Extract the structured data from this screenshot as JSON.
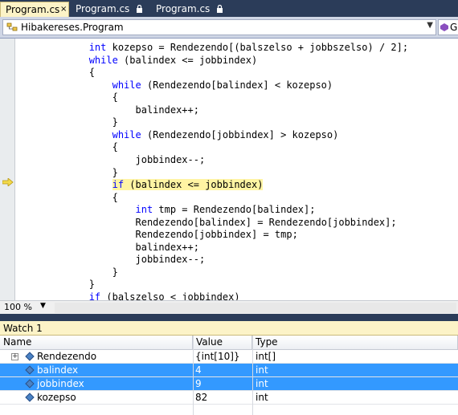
{
  "tabs": [
    {
      "label": "Program.cs",
      "active": true,
      "close_glyph": "×"
    },
    {
      "label": "Program.cs",
      "active": false,
      "locked": true
    },
    {
      "label": "Program.cs",
      "active": false,
      "locked": true
    }
  ],
  "navbar": {
    "type_combo": "Hibakereses.Program",
    "member_combo": "G"
  },
  "code": {
    "lines": [
      {
        "indent": "            ",
        "parts": [
          {
            "t": "int",
            "k": true
          },
          {
            "t": " kozepso = Rendezendo[(balszelso + jobbszelso) / 2];"
          }
        ]
      },
      {
        "indent": "            ",
        "parts": [
          {
            "t": "while",
            "k": true
          },
          {
            "t": " (balindex <= jobbindex)"
          }
        ]
      },
      {
        "indent": "            ",
        "parts": [
          {
            "t": "{"
          }
        ]
      },
      {
        "indent": "                ",
        "parts": [
          {
            "t": "while",
            "k": true
          },
          {
            "t": " (Rendezendo[balindex] < kozepso)"
          }
        ]
      },
      {
        "indent": "                ",
        "parts": [
          {
            "t": "{"
          }
        ]
      },
      {
        "indent": "                    ",
        "parts": [
          {
            "t": "balindex++;"
          }
        ]
      },
      {
        "indent": "                ",
        "parts": [
          {
            "t": "}"
          }
        ]
      },
      {
        "indent": "                ",
        "parts": [
          {
            "t": "while",
            "k": true
          },
          {
            "t": " (Rendezendo[jobbindex] > kozepso)"
          }
        ]
      },
      {
        "indent": "                ",
        "parts": [
          {
            "t": "{"
          }
        ]
      },
      {
        "indent": "                    ",
        "parts": [
          {
            "t": "jobbindex--;"
          }
        ]
      },
      {
        "indent": "                ",
        "parts": [
          {
            "t": "}"
          }
        ]
      },
      {
        "indent": "                ",
        "parts": [
          {
            "t": "if",
            "k": true
          },
          {
            "t": " (balindex <= jobbindex)"
          }
        ],
        "current": true
      },
      {
        "indent": "                ",
        "parts": [
          {
            "t": "{"
          }
        ]
      },
      {
        "indent": "                    ",
        "parts": [
          {
            "t": "int",
            "k": true
          },
          {
            "t": " tmp = Rendezendo[balindex];"
          }
        ]
      },
      {
        "indent": "                    ",
        "parts": [
          {
            "t": "Rendezendo[balindex] = Rendezendo[jobbindex];"
          }
        ]
      },
      {
        "indent": "                    ",
        "parts": [
          {
            "t": "Rendezendo[jobbindex] = tmp;"
          }
        ]
      },
      {
        "indent": "                    ",
        "parts": [
          {
            "t": "balindex++;"
          }
        ]
      },
      {
        "indent": "                    ",
        "parts": [
          {
            "t": "jobbindex--;"
          }
        ]
      },
      {
        "indent": "                ",
        "parts": [
          {
            "t": "}"
          }
        ]
      },
      {
        "indent": "            ",
        "parts": [
          {
            "t": "}"
          }
        ]
      },
      {
        "indent": "            ",
        "parts": [
          {
            "t": "if",
            "k": true
          },
          {
            "t": " (balszelso < jobbindex)"
          }
        ]
      }
    ],
    "keyword_color": "#0000ff",
    "current_line_color": "#fff4a3",
    "arrow_color": "#f2d94a"
  },
  "status": {
    "zoom": "100 %"
  },
  "watch": {
    "title": "Watch 1",
    "columns": [
      "Name",
      "Value",
      "Type"
    ],
    "rows": [
      {
        "name": "Rendezendo",
        "value": "{int[10]}",
        "type": "int[]",
        "expandable": true,
        "selected": false
      },
      {
        "name": "balindex",
        "value": "4",
        "type": "int",
        "expandable": false,
        "selected": true
      },
      {
        "name": "jobbindex",
        "value": "9",
        "type": "int",
        "expandable": false,
        "selected": true
      },
      {
        "name": "kozepso",
        "value": "82",
        "type": "int",
        "expandable": false,
        "selected": false
      }
    ],
    "selection_color": "#3399ff"
  }
}
